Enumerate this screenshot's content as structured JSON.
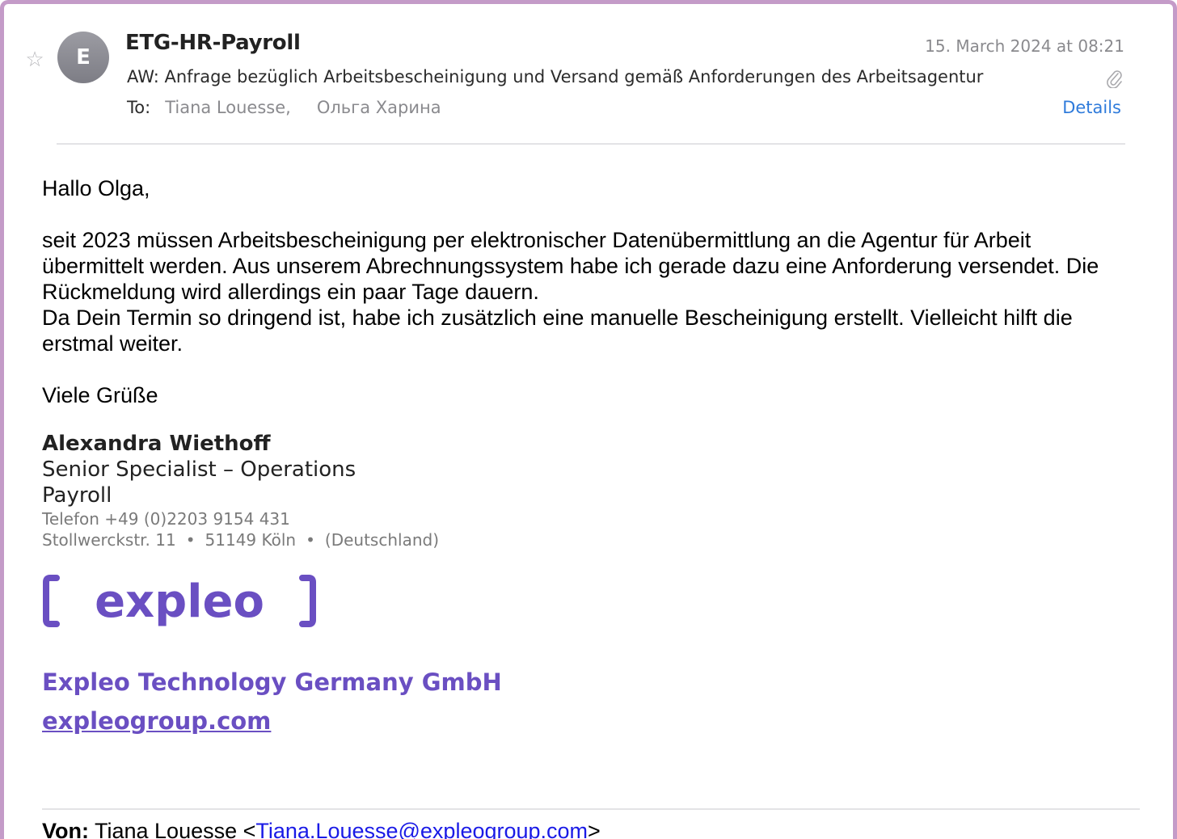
{
  "header": {
    "star_icon": "star-outline-icon",
    "avatar_initial": "E",
    "sender": "ETG-HR-Payroll",
    "date": "15. March 2024 at 08:21",
    "subject": "AW: Anfrage bezüglich Arbeitsbescheinigung und Versand gemäß Anforderungen des Arbeitsagentur",
    "attachment_icon": "paperclip-icon",
    "to_label": "To:",
    "recipients": [
      "Tiana Louesse",
      "Ольга Харина"
    ],
    "recipient_separator": ",",
    "details_label": "Details"
  },
  "body": {
    "greeting": "Hallo Olga,",
    "paragraph1": "seit 2023 müssen Arbeitsbescheinigung per elektronischer Datenübermittlung an die Agentur für Arbeit übermittelt werden. Aus unserem Abrechnungssystem habe ich gerade dazu eine Anforderung versendet. Die Rückmeldung wird allerdings ein paar Tage dauern.",
    "paragraph2": "Da Dein Termin so dringend ist, habe ich zusätzlich eine manuelle Bescheinigung erstellt. Vielleicht hilft die erstmal weiter.",
    "closing": "Viele Grüße"
  },
  "signature": {
    "name": "Alexandra Wiethoff",
    "role": "Senior Specialist – Operations",
    "department": "Payroll",
    "phone": "Telefon +49 (0)2203 9154 431",
    "street": "Stollwerckstr. 11",
    "city": "51149 Köln",
    "country": "(Deutschland)",
    "address_separator": "•",
    "logo_text": "expleo",
    "company": "Expleo Technology Germany GmbH",
    "website": "expleogroup.com"
  },
  "quoted": {
    "from_label": "Von:",
    "from_name": "Tiana Louesse <",
    "from_email": "Tiana.Louesse@expleogroup.com",
    "from_close": ">"
  },
  "colors": {
    "frame": "#c49bc8",
    "accent_link": "#2f7bdb",
    "brand_purple": "#6a4fc2",
    "mail_link": "#1a1ae6"
  }
}
